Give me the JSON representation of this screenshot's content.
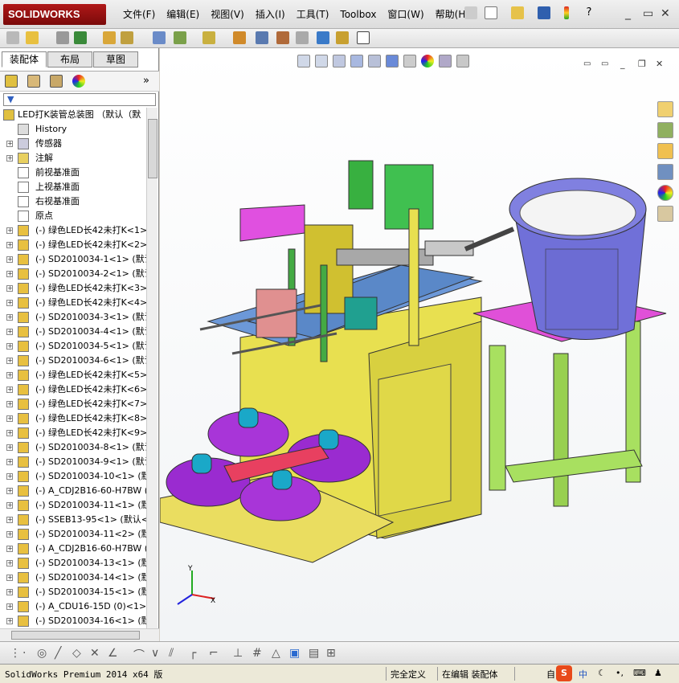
{
  "app": {
    "logo_text": "SOLIDWORKS",
    "brand_color": "#a01010"
  },
  "menu": [
    "文件(F)",
    "编辑(E)",
    "视图(V)",
    "插入(I)",
    "工具(T)",
    "Toolbox",
    "窗口(W)",
    "帮助(H)"
  ],
  "panel": {
    "tabs": [
      "装配体",
      "布局",
      "草图"
    ],
    "collapse_label": "»",
    "tree_root": "LED打K装管总装图 （默认（默",
    "tree": [
      {
        "label": "History",
        "icon": "history-icon"
      },
      {
        "label": "传感器",
        "icon": "sensor-icon"
      },
      {
        "label": "注解",
        "icon": "annotation-icon"
      },
      {
        "label": "前视基准面",
        "icon": "plane-icon"
      },
      {
        "label": "上视基准面",
        "icon": "plane-icon"
      },
      {
        "label": "右视基准面",
        "icon": "plane-icon"
      },
      {
        "label": "原点",
        "icon": "origin-icon"
      },
      {
        "label": "(-) 绿色LED长42未打K<1>",
        "icon": "part-icon"
      },
      {
        "label": "(-) 绿色LED长42未打K<2>",
        "icon": "part-icon"
      },
      {
        "label": "(-) SD2010034-1<1> (默认",
        "icon": "part-icon"
      },
      {
        "label": "(-) SD2010034-2<1> (默认",
        "icon": "part-icon"
      },
      {
        "label": "(-) 绿色LED长42未打K<3>",
        "icon": "part-icon"
      },
      {
        "label": "(-) 绿色LED长42未打K<4>",
        "icon": "part-icon"
      },
      {
        "label": "(-) SD2010034-3<1> (默认",
        "icon": "part-icon"
      },
      {
        "label": "(-) SD2010034-4<1> (默认",
        "icon": "part-icon"
      },
      {
        "label": "(-) SD2010034-5<1> (默认",
        "icon": "part-icon"
      },
      {
        "label": "(-) SD2010034-6<1> (默认",
        "icon": "part-icon"
      },
      {
        "label": "(-) 绿色LED长42未打K<5>",
        "icon": "part-icon"
      },
      {
        "label": "(-) 绿色LED长42未打K<6>",
        "icon": "part-icon"
      },
      {
        "label": "(-) 绿色LED长42未打K<7>",
        "icon": "part-icon"
      },
      {
        "label": "(-) 绿色LED长42未打K<8>",
        "icon": "part-icon"
      },
      {
        "label": "(-) 绿色LED长42未打K<9>",
        "icon": "part-icon"
      },
      {
        "label": "(-) SD2010034-8<1> (默认",
        "icon": "part-icon"
      },
      {
        "label": "(-) SD2010034-9<1> (默认",
        "icon": "part-icon"
      },
      {
        "label": "(-) SD2010034-10<1> (默",
        "icon": "part-icon"
      },
      {
        "label": "(-) A_CDJ2B16-60-H7BW (0",
        "icon": "part-icon"
      },
      {
        "label": "(-) SD2010034-11<1> (默",
        "icon": "part-icon"
      },
      {
        "label": "(-) SSEB13-95<1> (默认<",
        "icon": "part-icon"
      },
      {
        "label": "(-) SD2010034-11<2> (默",
        "icon": "part-icon"
      },
      {
        "label": "(-) A_CDJ2B16-60-H7BW (0",
        "icon": "part-icon"
      },
      {
        "label": "(-) SD2010034-13<1> (默",
        "icon": "part-icon"
      },
      {
        "label": "(-) SD2010034-14<1> (默",
        "icon": "part-icon"
      },
      {
        "label": "(-) SD2010034-15<1> (默",
        "icon": "part-icon"
      },
      {
        "label": "(-) A_CDU16-15D (0)<1>",
        "icon": "part-icon"
      },
      {
        "label": "(-) SD2010034-16<1> (默",
        "icon": "part-icon"
      }
    ]
  },
  "axes": {
    "x": "X",
    "y": "Y"
  },
  "status": {
    "product": "SolidWorks Premium 2014 x64 版",
    "definition": "完全定义",
    "mode": "在编辑 装配体",
    "ime_text": "自",
    "ime_lang": "中"
  }
}
